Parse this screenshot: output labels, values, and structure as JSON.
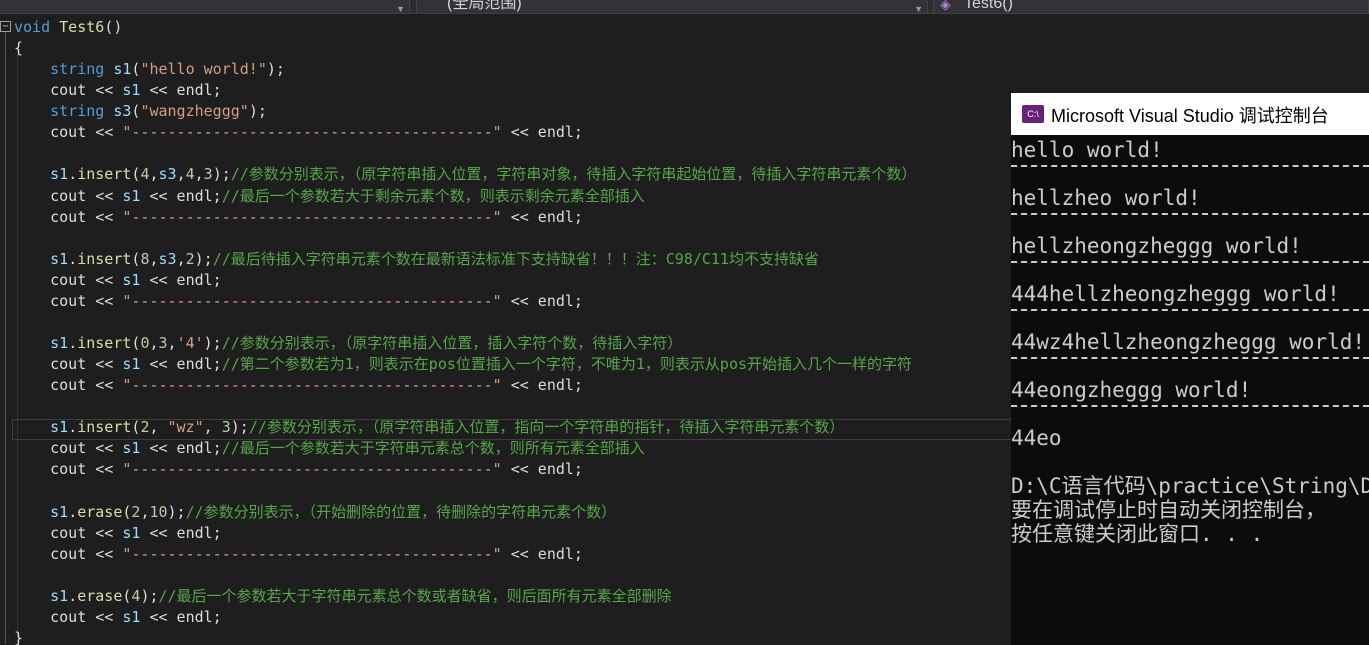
{
  "topbar": {
    "combo1_text": "",
    "combo2_text": "(全局范围)",
    "combo3_icon": "function-cube-icon",
    "combo3_text": "Test6()"
  },
  "code": [
    [
      [
        "c-kw",
        "void"
      ],
      [
        "c-plain",
        " "
      ],
      [
        "c-fn",
        "Test6"
      ],
      [
        "c-plain",
        "()"
      ]
    ],
    [
      [
        "c-plain",
        "{"
      ]
    ],
    [
      [
        "c-plain",
        "    "
      ],
      [
        "c-kw",
        "string"
      ],
      [
        "c-plain",
        " "
      ],
      [
        "c-var",
        "s1"
      ],
      [
        "c-plain",
        "("
      ],
      [
        "c-str",
        "\"hello world!\""
      ],
      [
        "c-plain",
        ");"
      ]
    ],
    [
      [
        "c-plain",
        "    cout << "
      ],
      [
        "c-var",
        "s1"
      ],
      [
        "c-plain",
        " << endl;"
      ]
    ],
    [
      [
        "c-plain",
        "    "
      ],
      [
        "c-kw",
        "string"
      ],
      [
        "c-plain",
        " "
      ],
      [
        "c-var",
        "s3"
      ],
      [
        "c-plain",
        "("
      ],
      [
        "c-str",
        "\"wangzheggg\""
      ],
      [
        "c-plain",
        ");"
      ]
    ],
    [
      [
        "c-plain",
        "    cout << "
      ],
      [
        "c-str",
        "\"----------------------------------------\""
      ],
      [
        "c-plain",
        " << endl;"
      ]
    ],
    [],
    [
      [
        "c-plain",
        "    "
      ],
      [
        "c-var",
        "s1"
      ],
      [
        "c-plain",
        "."
      ],
      [
        "c-fn",
        "insert"
      ],
      [
        "c-plain",
        "("
      ],
      [
        "c-num",
        "4"
      ],
      [
        "c-plain",
        ","
      ],
      [
        "c-var",
        "s3"
      ],
      [
        "c-plain",
        ","
      ],
      [
        "c-num",
        "4"
      ],
      [
        "c-plain",
        ","
      ],
      [
        "c-num",
        "3"
      ],
      [
        "c-plain",
        ");"
      ],
      [
        "c-cm",
        "//参数分别表示，（原字符串插入位置，字符串对象，待插入字符串起始位置，待插入字符串元素个数）"
      ]
    ],
    [
      [
        "c-plain",
        "    cout << "
      ],
      [
        "c-var",
        "s1"
      ],
      [
        "c-plain",
        " << endl;"
      ],
      [
        "c-cm",
        "//最后一个参数若大于剩余元素个数，则表示剩余元素全部插入"
      ]
    ],
    [
      [
        "c-plain",
        "    cout << "
      ],
      [
        "c-str",
        "\"----------------------------------------\""
      ],
      [
        "c-plain",
        " << endl;"
      ]
    ],
    [],
    [
      [
        "c-plain",
        "    "
      ],
      [
        "c-var",
        "s1"
      ],
      [
        "c-plain",
        "."
      ],
      [
        "c-fn",
        "insert"
      ],
      [
        "c-plain",
        "("
      ],
      [
        "c-num",
        "8"
      ],
      [
        "c-plain",
        ","
      ],
      [
        "c-var",
        "s3"
      ],
      [
        "c-plain",
        ","
      ],
      [
        "c-num",
        "2"
      ],
      [
        "c-plain",
        ");"
      ],
      [
        "c-cm",
        "//最后待插入字符串元素个数在最新语法标准下支持缺省！！！注：C98/C11均不支持缺省"
      ]
    ],
    [
      [
        "c-plain",
        "    cout << "
      ],
      [
        "c-var",
        "s1"
      ],
      [
        "c-plain",
        " << endl;"
      ]
    ],
    [
      [
        "c-plain",
        "    cout << "
      ],
      [
        "c-str",
        "\"----------------------------------------\""
      ],
      [
        "c-plain",
        " << endl;"
      ]
    ],
    [],
    [
      [
        "c-plain",
        "    "
      ],
      [
        "c-var",
        "s1"
      ],
      [
        "c-plain",
        "."
      ],
      [
        "c-fn",
        "insert"
      ],
      [
        "c-plain",
        "("
      ],
      [
        "c-num",
        "0"
      ],
      [
        "c-plain",
        ","
      ],
      [
        "c-num",
        "3"
      ],
      [
        "c-plain",
        ","
      ],
      [
        "c-str",
        "'4'"
      ],
      [
        "c-plain",
        ");"
      ],
      [
        "c-cm",
        "//参数分别表示，（原字符串插入位置，插入字符个数，待插入字符）"
      ]
    ],
    [
      [
        "c-plain",
        "    cout << "
      ],
      [
        "c-var",
        "s1"
      ],
      [
        "c-plain",
        " << endl;"
      ],
      [
        "c-cm",
        "//第二个参数若为1，则表示在pos位置插入一个字符，不唯为1，则表示从pos开始插入几个一样的字符"
      ]
    ],
    [
      [
        "c-plain",
        "    cout << "
      ],
      [
        "c-str",
        "\"----------------------------------------\""
      ],
      [
        "c-plain",
        " << endl;"
      ]
    ],
    [],
    [
      [
        "c-plain",
        "    "
      ],
      [
        "c-var",
        "s1"
      ],
      [
        "c-plain",
        "."
      ],
      [
        "c-fn",
        "insert"
      ],
      [
        "c-plain",
        "("
      ],
      [
        "c-num",
        "2"
      ],
      [
        "c-plain",
        ", "
      ],
      [
        "c-str",
        "\"wz\""
      ],
      [
        "c-plain",
        ", "
      ],
      [
        "c-num",
        "3"
      ],
      [
        "c-plain",
        ");"
      ],
      [
        "c-cm",
        "//参数分别表示，（原字符串插入位置，指向一个字符串的指针，待插入字符串元素个数）"
      ]
    ],
    [
      [
        "c-plain",
        "    cout << "
      ],
      [
        "c-var",
        "s1"
      ],
      [
        "c-plain",
        " << endl;"
      ],
      [
        "c-cm",
        "//最后一个参数若大于字符串元素总个数，则所有元素全部插入"
      ]
    ],
    [
      [
        "c-plain",
        "    cout << "
      ],
      [
        "c-str",
        "\"----------------------------------------\""
      ],
      [
        "c-plain",
        " << endl;"
      ]
    ],
    [],
    [
      [
        "c-plain",
        "    "
      ],
      [
        "c-var",
        "s1"
      ],
      [
        "c-plain",
        "."
      ],
      [
        "c-fn",
        "erase"
      ],
      [
        "c-plain",
        "("
      ],
      [
        "c-num",
        "2"
      ],
      [
        "c-plain",
        ","
      ],
      [
        "c-num",
        "10"
      ],
      [
        "c-plain",
        ");"
      ],
      [
        "c-cm",
        "//参数分别表示，（开始删除的位置，待删除的字符串元素个数）"
      ]
    ],
    [
      [
        "c-plain",
        "    cout << "
      ],
      [
        "c-var",
        "s1"
      ],
      [
        "c-plain",
        " << endl;"
      ]
    ],
    [
      [
        "c-plain",
        "    cout << "
      ],
      [
        "c-str",
        "\"----------------------------------------\""
      ],
      [
        "c-plain",
        " << endl;"
      ]
    ],
    [],
    [
      [
        "c-plain",
        "    "
      ],
      [
        "c-var",
        "s1"
      ],
      [
        "c-plain",
        "."
      ],
      [
        "c-fn",
        "erase"
      ],
      [
        "c-plain",
        "("
      ],
      [
        "c-num",
        "4"
      ],
      [
        "c-plain",
        ");"
      ],
      [
        "c-cm",
        "//最后一个参数若大于字符串元素总个数或者缺省，则后面所有元素全部删除"
      ]
    ],
    [
      [
        "c-plain",
        "    cout << "
      ],
      [
        "c-var",
        "s1"
      ],
      [
        "c-plain",
        " << endl;"
      ]
    ],
    [
      [
        "c-plain",
        "}"
      ]
    ]
  ],
  "console": {
    "icon_label": "C:\\",
    "title": "Microsoft Visual Studio 调试控制台",
    "lines": [
      "hello world!",
      "-",
      "hellzheo world!",
      "-",
      "hellzheongzheggg world!",
      "-",
      "444hellzheongzheggg world!",
      "-",
      "44wz4hellzheongzheggg world!",
      "-",
      "44eongzheggg world!",
      "-",
      "44eo",
      "",
      "D:\\C语言代码\\practice\\String\\D",
      "要在调试停止时自动关闭控制台，",
      "按任意键关闭此窗口. . ."
    ]
  }
}
